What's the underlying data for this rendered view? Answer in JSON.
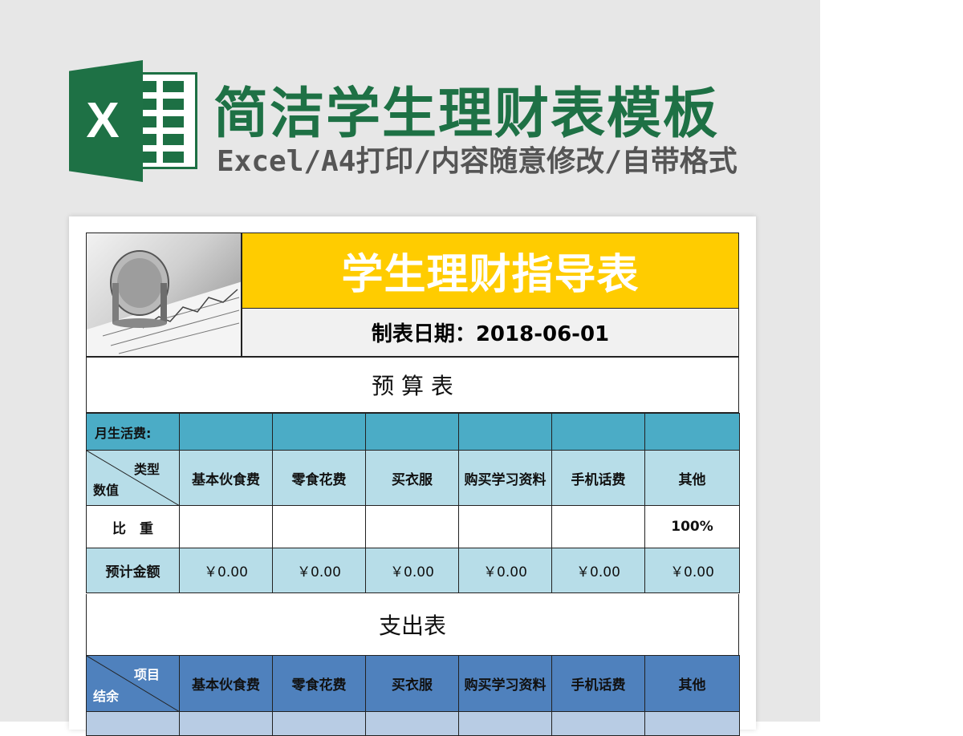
{
  "header": {
    "title": "简洁学生理财表模板",
    "subtitle": "Excel/A4打印/内容随意修改/自带格式"
  },
  "sheet": {
    "banner_title": "学生理财指导表",
    "date_line": "制表日期：2018-06-01",
    "budget": {
      "section_title": "预 算 表",
      "monthly_label": "月生活费:",
      "diag_top": "类型",
      "diag_bottom": "数值",
      "categories": [
        "基本伙食费",
        "零食花费",
        "买衣服",
        "购买学习资料",
        "手机话费",
        "其他"
      ],
      "ratio_label": "比　重",
      "ratios": [
        "",
        "",
        "",
        "",
        "",
        "100%"
      ],
      "estimate_label": "预计金额",
      "estimates": [
        "￥0.00",
        "￥0.00",
        "￥0.00",
        "￥0.00",
        "￥0.00",
        "￥0.00"
      ]
    },
    "expense": {
      "section_title": "支出表",
      "diag_top": "项目",
      "diag_bottom": "结余",
      "categories": [
        "基本伙食费",
        "零食花费",
        "买衣服",
        "购买学习资料",
        "手机话费",
        "其他"
      ]
    }
  },
  "colors": {
    "brand_green": "#1e7145",
    "banner_yellow": "#ffcc00",
    "teal": "#4bacc6",
    "light_teal": "#b7dde8",
    "blue": "#4f81bd",
    "light_blue": "#b8cce4"
  },
  "icons": {
    "logo": "excel-logo-icon",
    "photo": "coin-chart-photo"
  }
}
